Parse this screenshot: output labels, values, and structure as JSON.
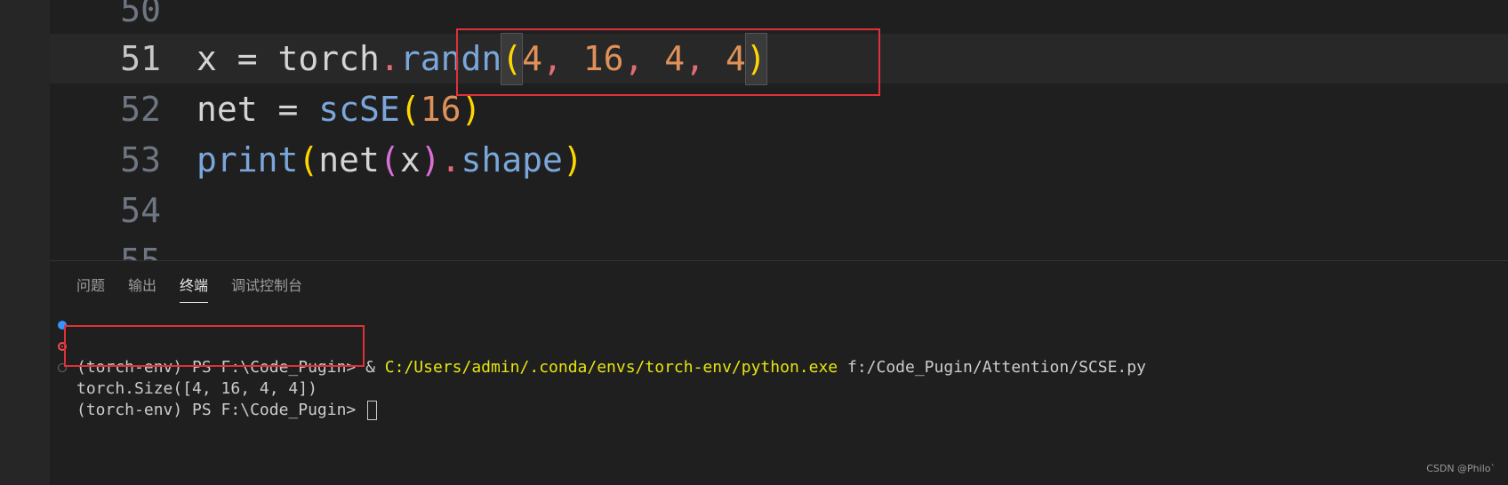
{
  "editor": {
    "lines": [
      {
        "number": "50",
        "active": false,
        "tokens": []
      },
      {
        "number": "51",
        "active": true,
        "tokens": [
          {
            "t": "x",
            "c": "tok-var"
          },
          {
            "t": " = ",
            "c": "tok-op"
          },
          {
            "t": "torch",
            "c": "tok-var"
          },
          {
            "t": ".",
            "c": "tok-dot"
          },
          {
            "t": "randn",
            "c": "tok-fn"
          },
          {
            "t": "(",
            "c": "tok-p1 bracket-box"
          },
          {
            "t": "4",
            "c": "tok-num"
          },
          {
            "t": ", ",
            "c": "tok-dot"
          },
          {
            "t": "16",
            "c": "tok-num"
          },
          {
            "t": ", ",
            "c": "tok-dot"
          },
          {
            "t": "4",
            "c": "tok-num"
          },
          {
            "t": ", ",
            "c": "tok-dot"
          },
          {
            "t": "4",
            "c": "tok-num"
          },
          {
            "t": ")",
            "c": "tok-p1 bracket-box"
          }
        ]
      },
      {
        "number": "52",
        "active": false,
        "tokens": [
          {
            "t": "net",
            "c": "tok-var"
          },
          {
            "t": " = ",
            "c": "tok-op"
          },
          {
            "t": "scSE",
            "c": "tok-fn"
          },
          {
            "t": "(",
            "c": "tok-p1"
          },
          {
            "t": "16",
            "c": "tok-num"
          },
          {
            "t": ")",
            "c": "tok-p1"
          }
        ]
      },
      {
        "number": "53",
        "active": false,
        "tokens": [
          {
            "t": "print",
            "c": "tok-fn"
          },
          {
            "t": "(",
            "c": "tok-p1"
          },
          {
            "t": "net",
            "c": "tok-var"
          },
          {
            "t": "(",
            "c": "tok-p2"
          },
          {
            "t": "x",
            "c": "tok-var"
          },
          {
            "t": ")",
            "c": "tok-p2"
          },
          {
            "t": ".",
            "c": "tok-dot"
          },
          {
            "t": "shape",
            "c": "tok-fn"
          },
          {
            "t": ")",
            "c": "tok-p1"
          }
        ]
      },
      {
        "number": "54",
        "active": false,
        "tokens": []
      },
      {
        "number": "55",
        "active": false,
        "tokens": []
      }
    ]
  },
  "panel": {
    "tabs": [
      {
        "label": "问题",
        "active": false
      },
      {
        "label": "输出",
        "active": false
      },
      {
        "label": "终端",
        "active": true
      },
      {
        "label": "调试控制台",
        "active": false
      }
    ]
  },
  "terminal": {
    "line1_prompt": "(torch-env) PS F:\\Code_Pugin> ",
    "line1_amp": "& ",
    "line1_exe": "C:/Users/admin/.conda/envs/torch-env/python.exe",
    "line1_arg": " f:/Code_Pugin/Attention/SCSE.py",
    "line2_output": "torch.Size([4, 16, 4, 4])",
    "line3_prompt": "(torch-env) PS F:\\Code_Pugin> "
  },
  "watermark": "CSDN @Philo`",
  "colors": {
    "annotation_box": "#e0313a",
    "background": "#1f1f1f",
    "success_dot": "#3794ff",
    "error_dot": "#f14c4c"
  }
}
